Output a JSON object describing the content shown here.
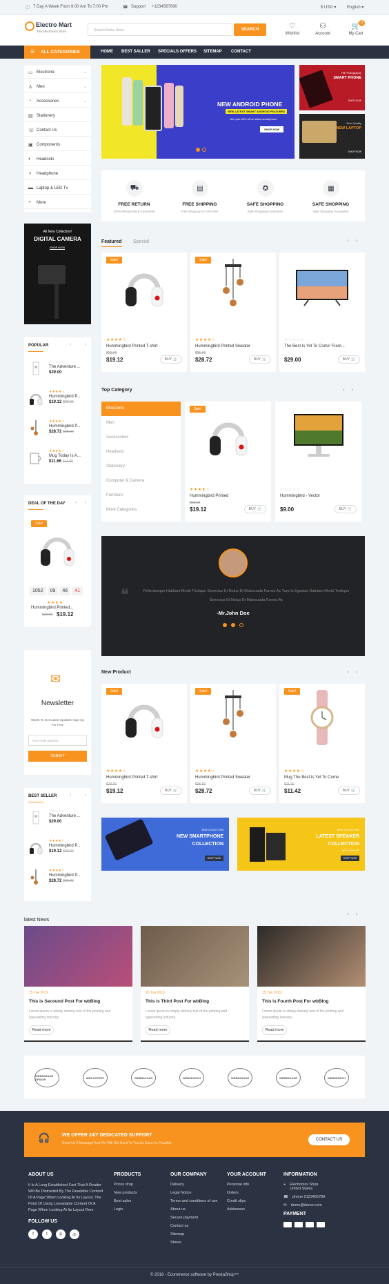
{
  "topbar": {
    "hours": "7 Day A Week From 9:00 Am To 7:00 Pm",
    "support_label": "Support",
    "phone": "+1234567890",
    "currency": "$ USD",
    "language": "English"
  },
  "header": {
    "logo_title": "Electro Mart",
    "logo_sub": "The Electronics Store",
    "search_placeholder": "Search Entire Store",
    "search_button": "SEARCH",
    "wishlist": "Wishlist",
    "account": "Account",
    "cart": "My Cart",
    "cart_count": "0"
  },
  "nav": {
    "categories": "ALL CATEGORIES",
    "items": [
      "HOME",
      "BEST SALLER",
      "SPECIALS OFFERS",
      "SITEMAP",
      "CONTACT"
    ]
  },
  "sidebar_cats": [
    "Electronic",
    "Men",
    "Accessories",
    "Stationery",
    "Contact Us",
    "Components",
    "Headsets",
    "Headphone",
    "Laptop & LED Tv",
    "More"
  ],
  "hero": {
    "title": "NEW ANDROID PHONE",
    "tag": "NEW LATEST SMART ANDROID FEATURES",
    "desc": "Get upto 40% off on latest smartphone",
    "button": "SHOP NOW",
    "side1_small": "Hd Photography",
    "side1_title": "SMART PHONE",
    "side1_btn": "SHOP NOW",
    "side2_small": "New Quality",
    "side2_title": "NEW LAPTOP",
    "side2_btn": "SHOP NOW"
  },
  "services": [
    {
      "title": "FREE RETURN",
      "sub": "100% Money Back Guarantee"
    },
    {
      "title": "FREE SHIPPING",
      "sub": "Free Shipping On All Order"
    },
    {
      "title": "SAFE SHOPPING",
      "sub": "Safe Shopping Guarantee"
    },
    {
      "title": "SAFE SHOPPING",
      "sub": "Safe Shopping Guarantee"
    }
  ],
  "camera_banner": {
    "small": "All New Collection!",
    "title": "DIGITAL CAMERA",
    "button": "SHOP NOW"
  },
  "popular": {
    "title": "POPULAR",
    "items": [
      {
        "name": "The Adventure ...",
        "price": "$29.00",
        "old": ""
      },
      {
        "name": "Hummingbird P...",
        "price": "$19.12",
        "old": "$23.90"
      },
      {
        "name": "Hummingbird P...",
        "price": "$28.72",
        "old": "$35.90"
      },
      {
        "name": "Mug Today Is A...",
        "price": "$11.66",
        "old": "$11.90"
      }
    ]
  },
  "deal": {
    "title": "DEAL OF THE DAY",
    "sale": "Sale!",
    "timer": [
      "1052",
      "09",
      "46",
      "41"
    ],
    "name": "Hummingbird Printed...",
    "old": "$23.90",
    "price": "$19.12"
  },
  "newsletter": {
    "title": "Newsletter",
    "desc": "Wants To Get Latest Updates! Sign Up For Free",
    "placeholder": "Your email address",
    "button": "SUBMIT"
  },
  "bestseller": {
    "title": "BEST SELLER",
    "items": [
      {
        "name": "The Adventure ...",
        "price": "$29.00",
        "old": ""
      },
      {
        "name": "Hummingbird P...",
        "price": "$19.12",
        "old": "$23.90"
      },
      {
        "name": "Hummingbird P...",
        "price": "$28.72",
        "old": "$35.90"
      }
    ]
  },
  "featured": {
    "tab1": "Featured",
    "tab2": "Special",
    "products": [
      {
        "name": "Hummingbird Printed T-shirt",
        "old": "$23.90",
        "price": "$19.12",
        "sale": "Sale!",
        "buy": "BUY"
      },
      {
        "name": "Hummingbird Printed Sweater",
        "old": "$35.90",
        "price": "$28.72",
        "sale": "Sale!",
        "buy": "BUY"
      },
      {
        "name": "The Best Is Yet To Come' Fram...",
        "old": "",
        "price": "$29.00",
        "sale": "",
        "buy": "BUY"
      }
    ]
  },
  "topcat": {
    "title": "Top Category",
    "items": [
      "Electronic",
      "Men",
      "Accessories",
      "Headsets",
      "Stationery",
      "Computer & Camera",
      "Furniture",
      "More Categories"
    ],
    "products": [
      {
        "name": "Hummingbird Printed",
        "old": "$23.90",
        "price": "$19.12",
        "sale": "Sale!",
        "buy": "BUY"
      },
      {
        "name": "Hummingbird - Vector",
        "old": "",
        "price": "$9.00",
        "sale": "",
        "buy": "BUY"
      }
    ]
  },
  "testimonial": {
    "text": "Pellentesque Habitant Morbi Tristique Senectus Et Netus Et Malesuada Fames Ac Turp Is Egestas Habitant Morbi Tristique Senectus Et Netus Et Malesuada Fames Ac",
    "author": "-Mr.John Doe"
  },
  "newproduct": {
    "title": "New Product",
    "products": [
      {
        "name": "Hummingbird Printed T-shirt",
        "old": "$23.90",
        "price": "$19.12",
        "sale": "Sale!",
        "buy": "BUY"
      },
      {
        "name": "Hummingbird Printed Sweater",
        "old": "$35.90",
        "price": "$28.72",
        "sale": "Sale!",
        "buy": "BUY"
      },
      {
        "name": "Mug The Best Is Yet To Come",
        "old": "$11.90",
        "price": "$11.42",
        "sale": "Sale!",
        "buy": "BUY"
      }
    ]
  },
  "banners": {
    "b1_small": "NEW COLLECTION",
    "b1_title1": "NEW SMARTPHONE",
    "b1_title2": "COLLECTION",
    "b1_btn": "SHOP NOW",
    "b2_small": "BEST COLLECTION",
    "b2_title1": "LATEST SPEAKER",
    "b2_title2": "COLLECTION",
    "b2_sub": "UPTO 20% OFF",
    "b2_btn": "SHOP NOW"
  },
  "news": {
    "title": "latest News",
    "items": [
      {
        "date": "15 Tue 2019",
        "title": "This is Secound Post For wbBlog",
        "excerpt": "Lorem ipsum is simply dummy text of the printing and typesetting industry.",
        "button": "Read more"
      },
      {
        "date": "15 Tue 2019",
        "title": "This is Third Post For wbBlog",
        "excerpt": "Lorem ipsum is simply dummy text of the printing and typesetting industry.",
        "button": "Read more"
      },
      {
        "date": "15 Tue 2019",
        "title": "This is Fourth Post For wbBlog",
        "excerpt": "Lorem ipsum is simply dummy text of the printing and typesetting industry.",
        "button": "Read more"
      }
    ]
  },
  "brands": [
    "WEBBAZAAR DESIGN",
    "WEB EXPERT",
    "WEBBAZAAR",
    "WEBSEARCH",
    "WEBBAZAAR",
    "WEBBAZAAR",
    "WEBSEARCH"
  ],
  "footer": {
    "cta_title": "WE OFFER 24/7 DEDICATED SUPPORT",
    "cta_sub": "Send Us A Message And We Will Get Back To You As Soon As Possible",
    "cta_btn": "CONTACT US",
    "about_title": "ABOUT US",
    "about_text": "It Is A Long Established Fact That A Reader Will Be Distracted By The Readable Content Of A Page When Looking At Its Layout. The Point Of Using Loreadable Content Of A Page When Looking At Its Layout Rem",
    "follow": "FOLLOW US",
    "products_title": "PRODUCTS",
    "products": [
      "Prices drop",
      "New products",
      "Best sales",
      "Login"
    ],
    "company_title": "OUR COMPANY",
    "company": [
      "Delivery",
      "Legal Notice",
      "Terms and conditions of use",
      "About us",
      "Secure payment",
      "Contact us",
      "Sitemap",
      "Stores"
    ],
    "account_title": "YOUR ACCOUNT",
    "account": [
      "Personal info",
      "Orders",
      "Credit slips",
      "Addresses"
    ],
    "info_title": "INFORMATION",
    "info_address": "Electronics Shop United States",
    "info_phone": "phone 0123456789",
    "info_email": "demo@demo.com",
    "payment": "PAYMENT",
    "copyright": "© 2018 - Ecommerce software by PrestaShop™"
  }
}
